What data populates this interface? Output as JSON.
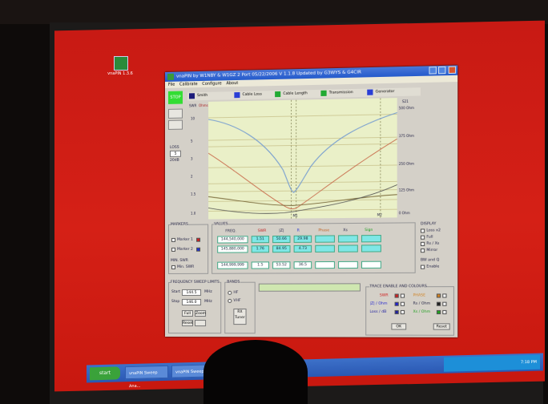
{
  "window": {
    "title": "vnaPIN by W1NBY & W1GZ   2 Port   05/22/2006   V 1.1.8   Updated by G3WYS & G4CIR",
    "menu": [
      "File",
      "Calibrate",
      "Configure",
      "About"
    ]
  },
  "desktop": {
    "icon_label": "vnaPIN 1.3.6",
    "start_label": "start",
    "task_items": [
      "vnaPIN Sweep Ana...",
      "vnaPIN Sweep"
    ],
    "clock": "7:18 PM"
  },
  "left_panel": {
    "run_label": "STOP",
    "loss_label": "LOSS",
    "loss_value": "5",
    "loss_unit": "20dB"
  },
  "graph": {
    "tabs": [
      {
        "label": "Smith",
        "color": "#1d1d7a"
      },
      {
        "label": "Cable Loss",
        "color": "#2a3ed6"
      },
      {
        "label": "Cable Length",
        "color": "#22aa33"
      },
      {
        "label": "Transmission",
        "color": "#2a3ed6"
      },
      {
        "label": "Generator",
        "color": "#2a3ed6"
      }
    ],
    "left_axis_head": "SWR",
    "left_axis_head2": "Ohms",
    "left_ticks": [
      "10",
      "5",
      "3",
      "2",
      "1.5",
      "1.0"
    ],
    "right_axis_head": "S21",
    "right_ticks": [
      "500 Ohm",
      "375 Ohm",
      "250 Ohm",
      "125 Ohm",
      "0 Ohm"
    ],
    "marker1": "M1",
    "marker2": "M2"
  },
  "markers": {
    "title": "MARKERS",
    "m1": "Marker 1",
    "m2": "Marker 2",
    "min_swr_title": "MIN. SWR",
    "min_swr": "Min. SWR"
  },
  "values": {
    "title": "VALUES",
    "headers": [
      "FREQ.",
      "SWR",
      "|Z|",
      "R",
      "Phase",
      "Xs",
      "Sign"
    ],
    "rows": [
      {
        "freq": "144,540,000",
        "cells": [
          "1.51",
          "50.66",
          "29.98",
          "",
          "",
          ""
        ]
      },
      {
        "freq": "145,880,000",
        "cells": [
          "1.76",
          "84.95",
          "4.73",
          "",
          "",
          ""
        ]
      },
      {
        "freq": "144,999,999",
        "cells": [
          "1.5",
          "53.52",
          "36.5",
          "",
          "",
          ""
        ]
      }
    ]
  },
  "display": {
    "title": "DISPLAY",
    "options": [
      "Loss x2",
      "Full",
      "Rs / Xs",
      "Mirror"
    ],
    "bw_title": "BW and Q",
    "bw_option": "Enable"
  },
  "frequency": {
    "title": "FREQUENCY SWEEP LIMITS",
    "start_label": "Start",
    "start_value": "144.5",
    "stop_label": "Stop",
    "stop_value": "146.0",
    "unit": "MHz",
    "full_btn": "Full",
    "zoom_btn": "Zoom",
    "reset_btn": "Reset"
  },
  "bands": {
    "title": "BANDS",
    "options": [
      "HF",
      "VHF"
    ],
    "note": "RX Tuner"
  },
  "trace": {
    "title": "TRACE ENABLE AND COLOURS",
    "items": [
      "SWR",
      "PHASE",
      "|Z| / Ohm",
      "Rs / Ohm",
      "Loss / dB",
      "Xs / Ohm"
    ],
    "colors": [
      "#d02020",
      "#d08020",
      "#2020d0",
      "#202020",
      "#2020a0",
      "#20a020"
    ],
    "ok_btn": "OK",
    "reset_btn": "Reset"
  }
}
